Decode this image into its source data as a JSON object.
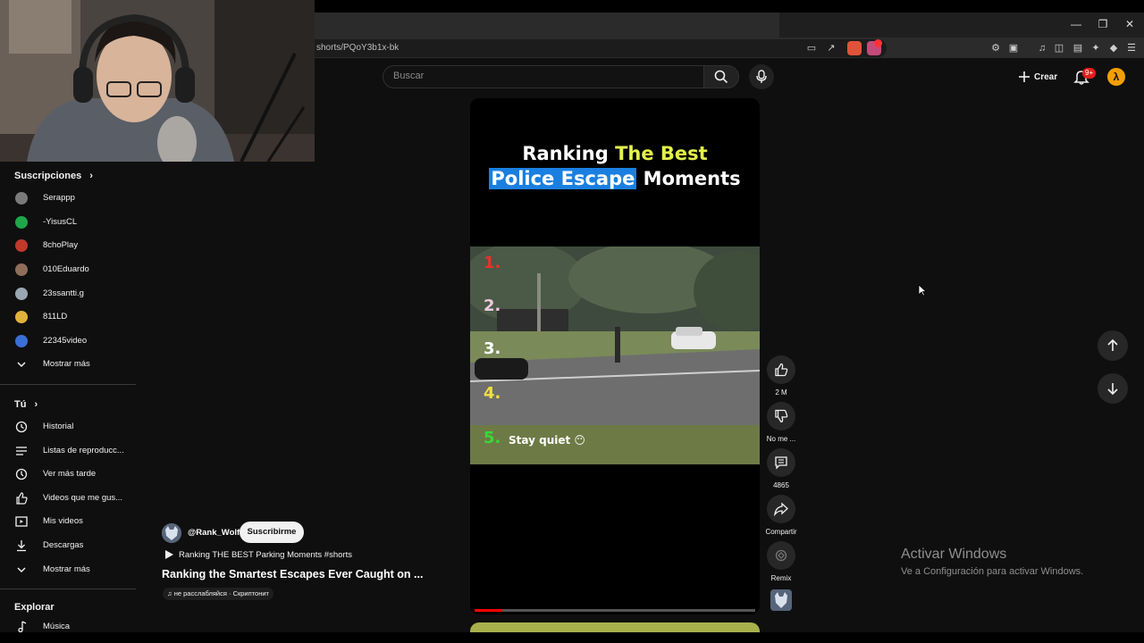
{
  "browser": {
    "url": "shorts/PQoY3b1x-bk",
    "brave_badge": "1"
  },
  "header": {
    "search_placeholder": "Buscar",
    "create_label": "Crear",
    "notifications_badge": "9+",
    "avatar_letter": "λ"
  },
  "sidebar": {
    "subscriptions_heading": "Suscripciones",
    "subscriptions": [
      {
        "label": "Serappp",
        "color": "#7a7a7a"
      },
      {
        "label": "-YisusCL",
        "color": "#1fa64a"
      },
      {
        "label": "8choPlay",
        "color": "#c0392b"
      },
      {
        "label": "010Eduardo",
        "color": "#8e6e5a"
      },
      {
        "label": "23ssantti.g",
        "color": "#9aa6b2"
      },
      {
        "label": "811LD",
        "color": "#e0b23a"
      },
      {
        "label": "22345video",
        "color": "#3b6fd8"
      }
    ],
    "show_more_1": "Mostrar más",
    "you_heading": "Tú",
    "you_items": [
      {
        "label": "Historial",
        "icon": "history-icon"
      },
      {
        "label": "Listas de reproducc...",
        "icon": "playlists-icon"
      },
      {
        "label": "Ver más tarde",
        "icon": "watch-later-icon"
      },
      {
        "label": "Videos que me gus...",
        "icon": "liked-icon"
      },
      {
        "label": "Mis videos",
        "icon": "my-videos-icon"
      },
      {
        "label": "Descargas",
        "icon": "download-icon"
      }
    ],
    "show_more_2": "Mostrar más",
    "explore_heading": "Explorar",
    "explore_items": [
      {
        "label": "Música",
        "icon": "music-icon"
      }
    ]
  },
  "short": {
    "title_line1_a": "Ranking ",
    "title_line1_b": "The Best",
    "title_line2_a": "Police Escape",
    "title_line2_b": " Moments",
    "ranks": [
      {
        "label": "1.",
        "color": "#e8322a"
      },
      {
        "label": "2.",
        "color": "#f0c8e0"
      },
      {
        "label": "3.",
        "color": "#ffffff"
      },
      {
        "label": "4.",
        "color": "#f0e040"
      },
      {
        "label": "5.",
        "color": "#38d838"
      }
    ],
    "caption": "Stay quiet 😶",
    "progress_fraction": 0.1
  },
  "actions": {
    "like_count": "2 M",
    "dislike_label": "No me ...",
    "comments_count": "4865",
    "share_label": "Compartir",
    "remix_label": "Remix"
  },
  "meta": {
    "channel": "@Rank_Wolf",
    "subscribe_label": "Suscribirme",
    "playlist_line": "Ranking THE BEST Parking Moments #shorts",
    "title": "Ranking the Smartest Escapes Ever Caught on ...",
    "music": "не расслабляйся · Скриптонит"
  },
  "overlay": {
    "activate_title": "Activar Windows",
    "activate_sub": "Ve a Configuración para activar Windows."
  }
}
